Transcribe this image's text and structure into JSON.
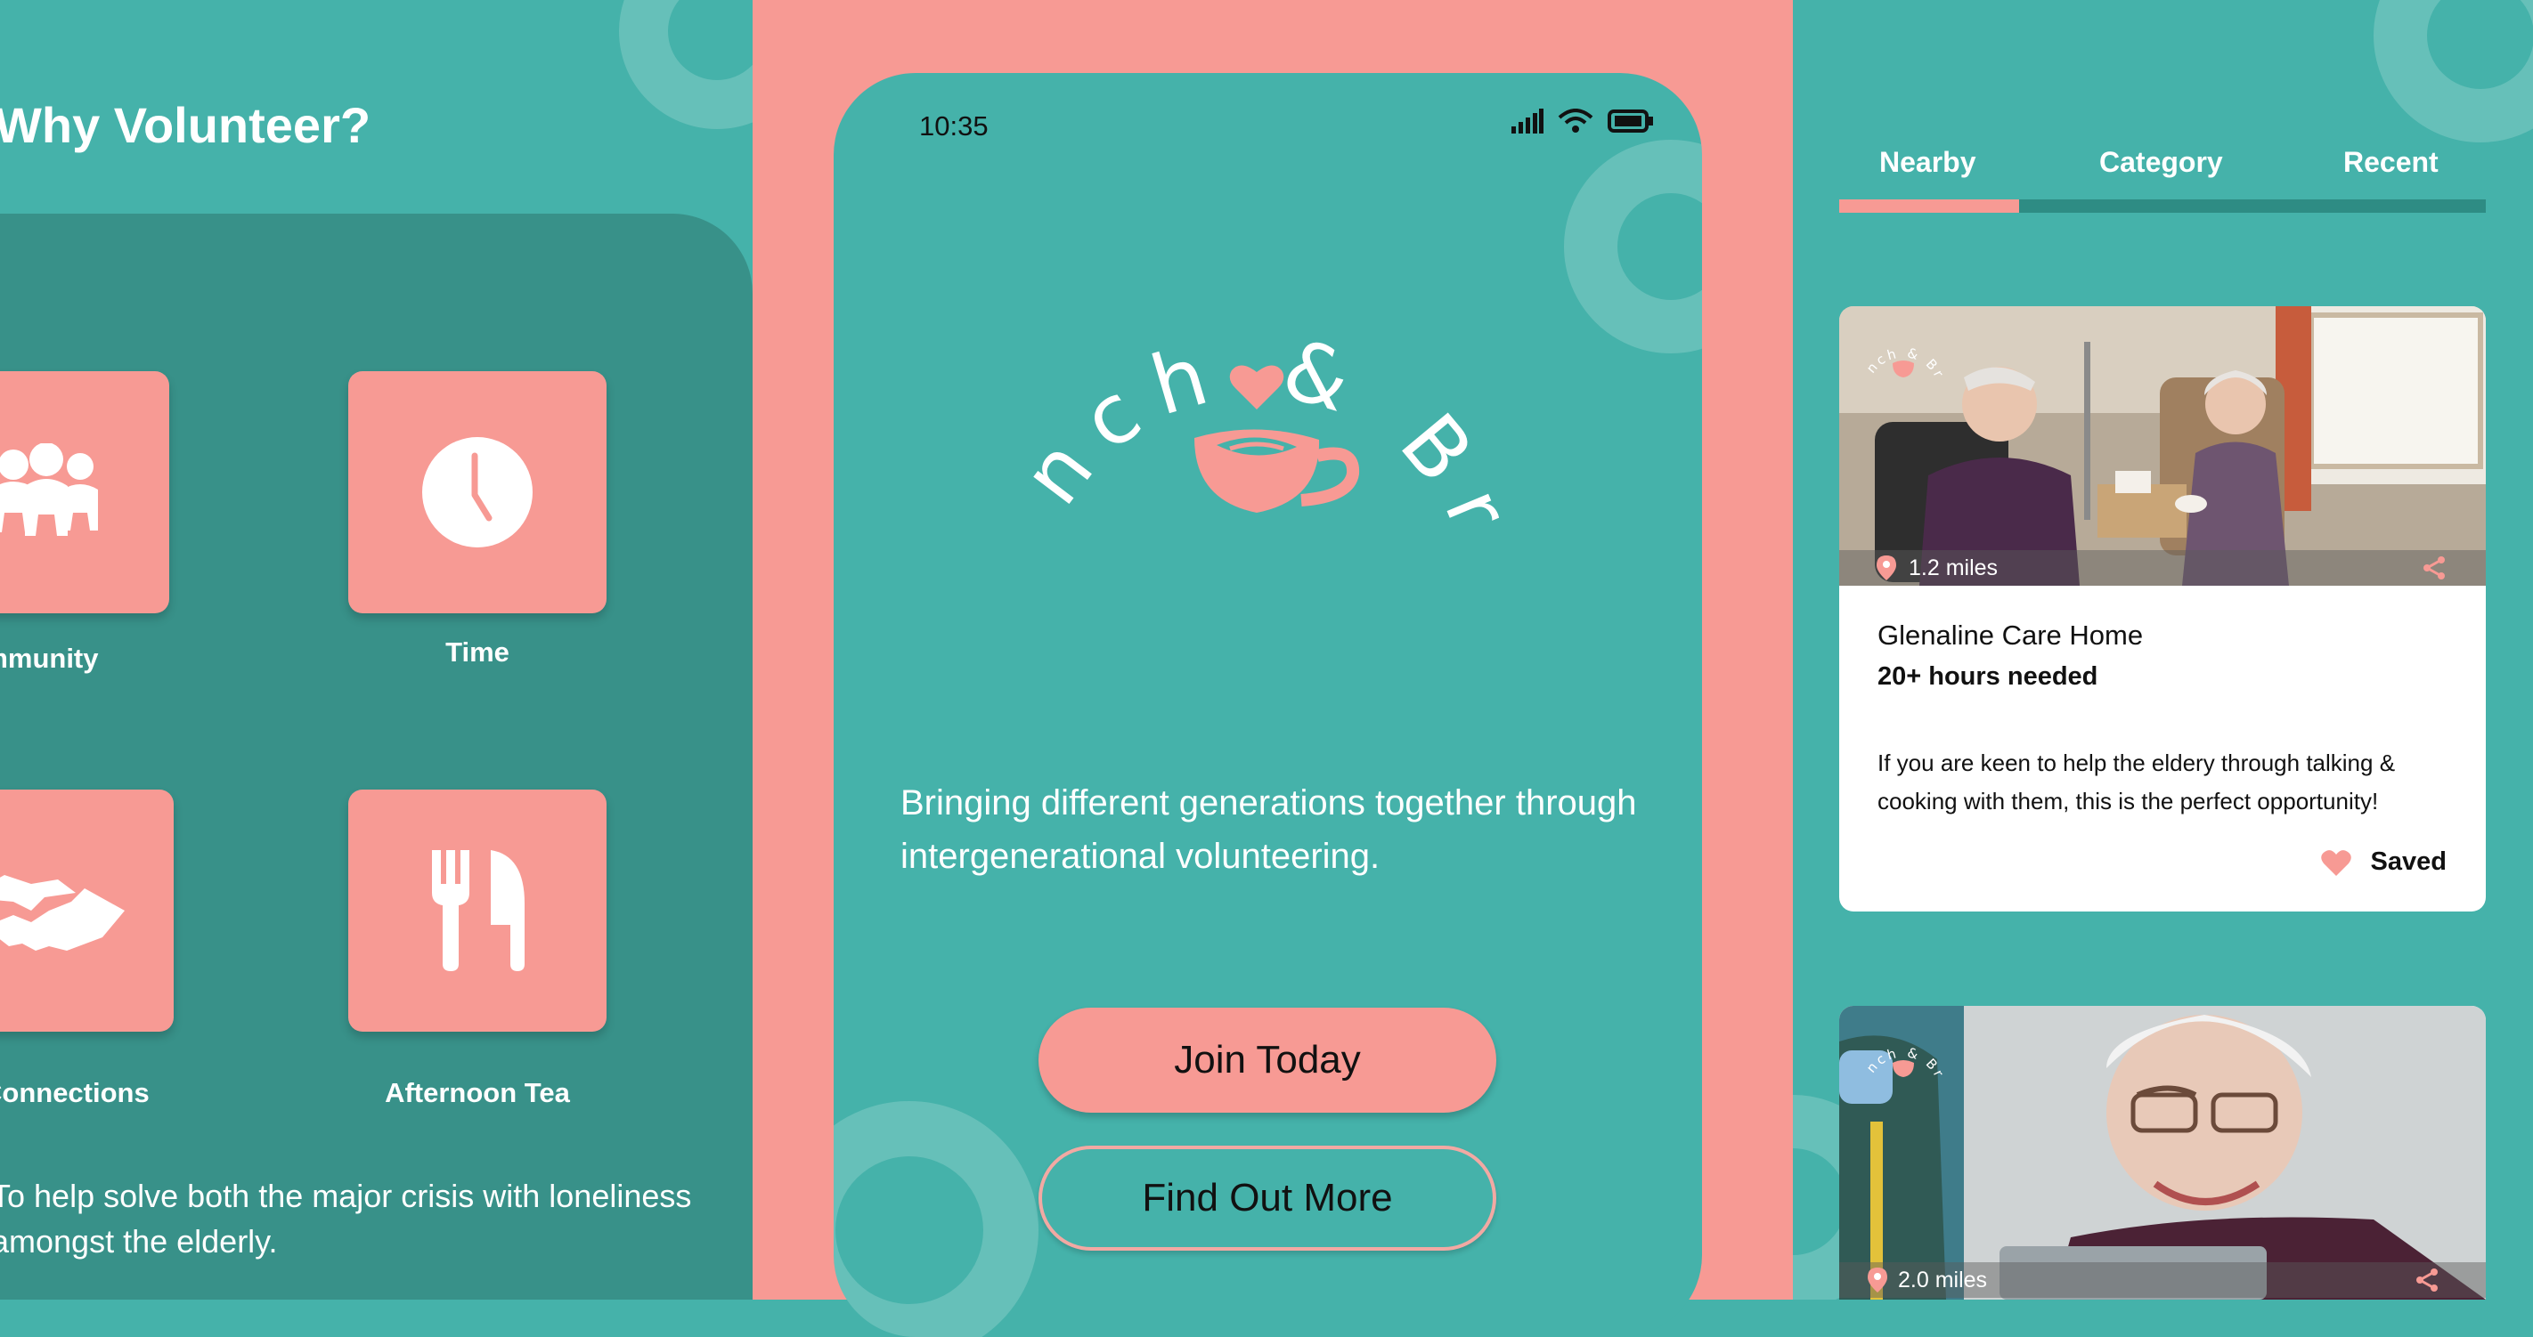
{
  "colors": {
    "teal": "#45b2aa",
    "dark_teal": "#389189",
    "coral": "#f79a94",
    "white": "#ffffff"
  },
  "left": {
    "title": "Why Volunteer?",
    "tiles": [
      {
        "label": "Community",
        "icon": "people-icon"
      },
      {
        "label": "Time",
        "icon": "clock-icon"
      },
      {
        "label": "Connections",
        "icon": "handshake-icon"
      },
      {
        "label": "Afternoon Tea",
        "icon": "cutlery-icon"
      }
    ],
    "body": "To help solve both the major crisis with loneliness amongst the elderly."
  },
  "phone": {
    "time": "10:35",
    "status_icons": [
      "signal-icon",
      "wifi-icon",
      "battery-icon"
    ],
    "logo_text": "Brunch & Brew",
    "tagline": "Bringing different generations together through intergenerational volunteering.",
    "join_label": "Join Today",
    "find_label": "Find Out More"
  },
  "right": {
    "tabs": [
      {
        "label": "Nearby",
        "active": true
      },
      {
        "label": "Category",
        "active": false
      },
      {
        "label": "Recent",
        "active": false
      }
    ],
    "cards": [
      {
        "distance": "1.2 miles",
        "title": "Glenaline Care Home",
        "hours": "20+ hours needed",
        "description": "If you are keen to help the eldery through talking & cooking with them, this is the perfect opportunity!",
        "saved_label": "Saved"
      },
      {
        "distance": "2.0 miles"
      }
    ],
    "logo_text": "Brunch & Brew"
  }
}
